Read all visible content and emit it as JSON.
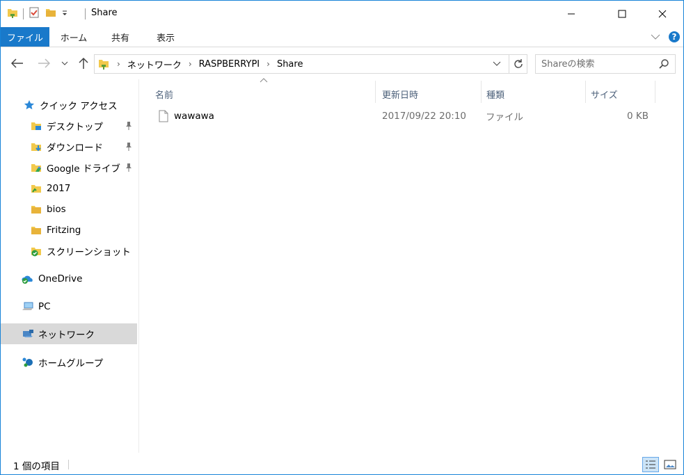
{
  "window": {
    "title": "Share"
  },
  "ribbon": {
    "tabs": [
      {
        "label": "ファイル",
        "active": true
      },
      {
        "label": "ホーム",
        "active": false
      },
      {
        "label": "共有",
        "active": false
      },
      {
        "label": "表示",
        "active": false
      }
    ]
  },
  "address": {
    "crumbs": [
      "ネットワーク",
      "RASPBERRYPI",
      "Share"
    ]
  },
  "search": {
    "placeholder": "Shareの検索"
  },
  "nav": {
    "quick_access": "クイック アクセス",
    "quick_items": [
      {
        "label": "デスクトップ",
        "icon": "desktop-folder-icon",
        "pinned": true
      },
      {
        "label": "ダウンロード",
        "icon": "download-folder-icon",
        "pinned": true
      },
      {
        "label": "Google ドライブ",
        "icon": "google-drive-folder-icon",
        "pinned": true
      },
      {
        "label": "2017",
        "icon": "synced-folder-icon",
        "pinned": false
      },
      {
        "label": "bios",
        "icon": "folder-icon",
        "pinned": false
      },
      {
        "label": "Fritzing",
        "icon": "folder-icon",
        "pinned": false
      },
      {
        "label": "スクリーンショット",
        "icon": "synced-check-folder-icon",
        "pinned": false
      }
    ],
    "onedrive": "OneDrive",
    "pc": "PC",
    "network": "ネットワーク",
    "homegroup": "ホームグループ"
  },
  "columns": {
    "name": "名前",
    "date": "更新日時",
    "type": "種類",
    "size": "サイズ"
  },
  "files": [
    {
      "name": "wawawa",
      "date": "2017/09/22 20:10",
      "type": "ファイル",
      "size": "0 KB"
    }
  ],
  "status": {
    "count_text": "1 個の項目"
  },
  "colors": {
    "accent": "#1979ca",
    "selected_nav": "#d9d9d9",
    "header_text": "#4c607a"
  }
}
